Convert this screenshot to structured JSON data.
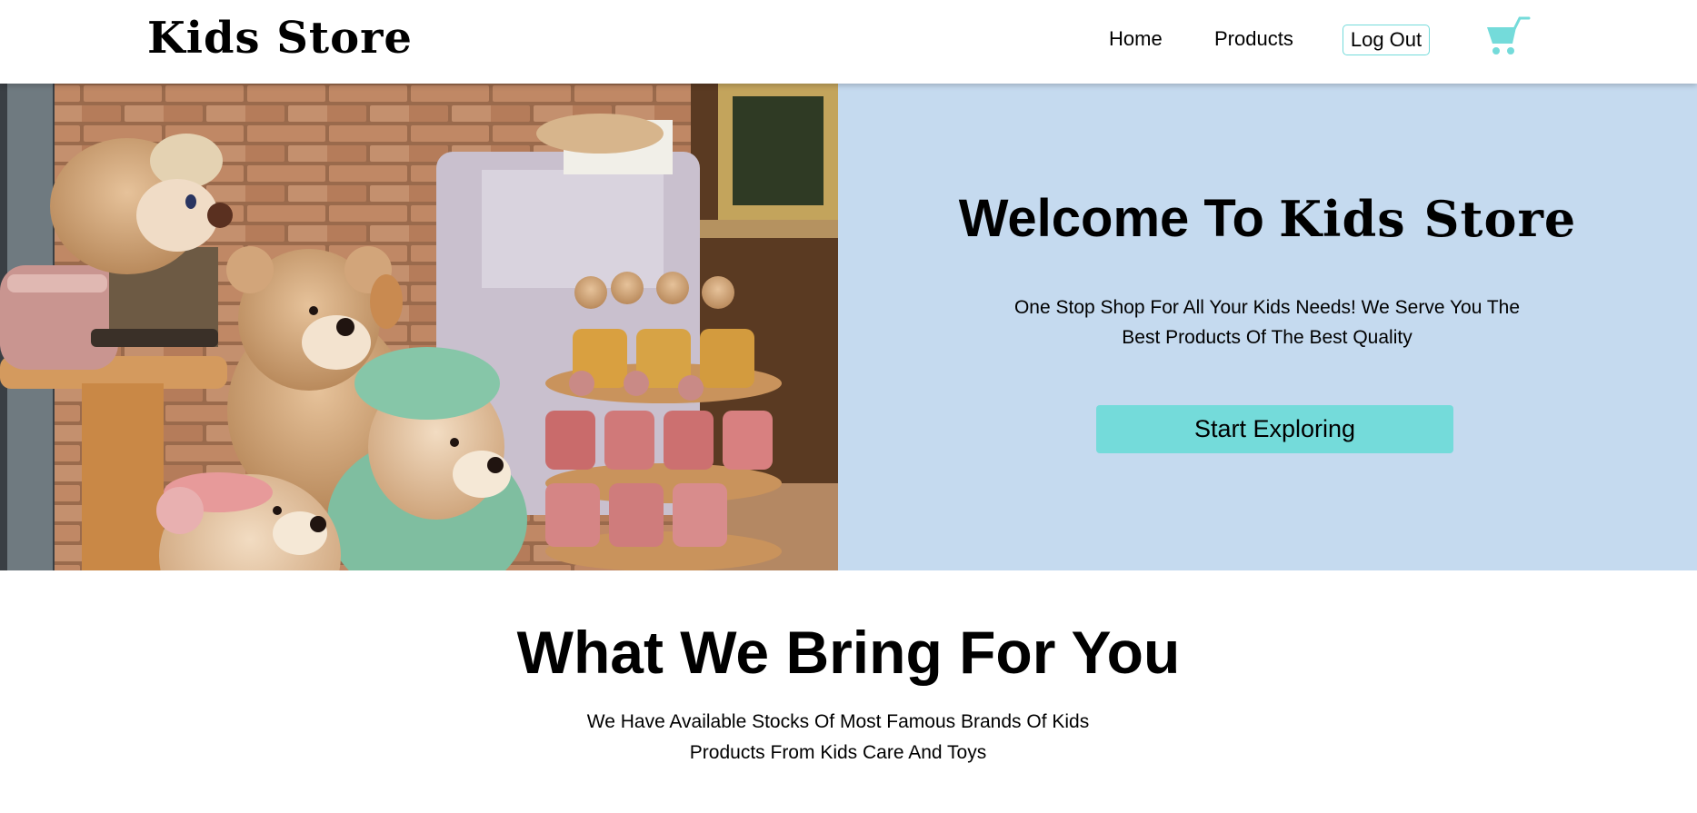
{
  "header": {
    "logo": "Kids Store",
    "nav": {
      "home": "Home",
      "products": "Products"
    },
    "logout_label": "Log Out",
    "cart_icon": "shopping-cart-icon"
  },
  "hero": {
    "welcome_prefix": "Welcome To",
    "welcome_brand": "Kids Store",
    "description": "One Stop Shop For All Your Kids Needs! We Serve You The Best Products Of The Best Quality",
    "cta_label": "Start Exploring",
    "image": "teddy-bear-toy-shop-photo"
  },
  "section": {
    "title": "What We Bring For You",
    "description": "We Have Available Stocks Of Most Famous Brands Of Kids Products From Kids Care And Toys"
  },
  "colors": {
    "accent": "#74dbda",
    "hero_panel": "#c5daef",
    "text": "#000000",
    "background": "#ffffff"
  }
}
